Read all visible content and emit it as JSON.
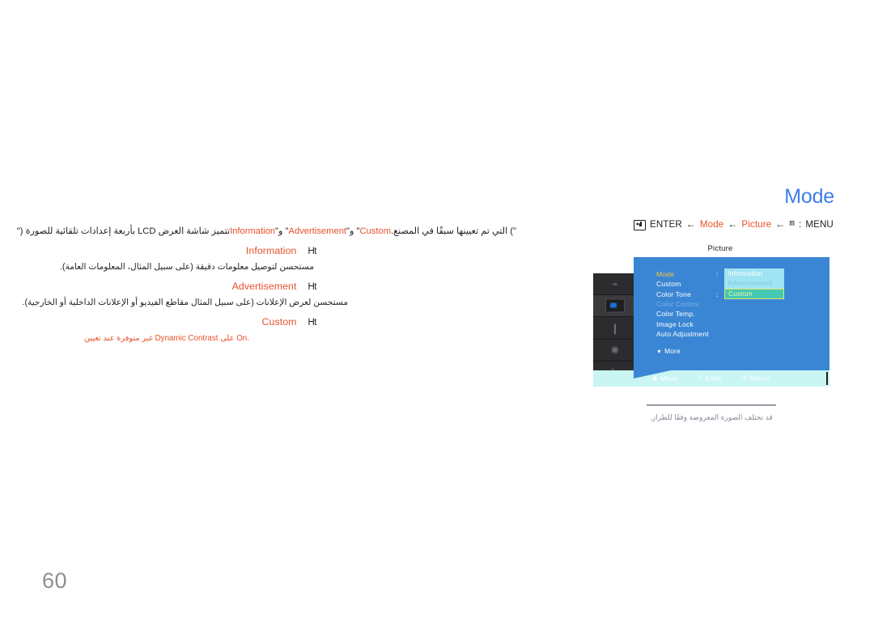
{
  "page": {
    "number": "60",
    "language": "ar"
  },
  "section": {
    "title": "Mode"
  },
  "breadcrumb": {
    "enter_icon": "enter-key-icon",
    "enter_label": "ENTER",
    "arrow": "←",
    "step_mode": "Mode",
    "step_picture": "Picture",
    "menu_glyph": "m",
    "menu_separator": ":",
    "menu_label": "MENU"
  },
  "body": {
    "intro": "تتميز شاشة العرض LCD بأربعة إعدادات تلقائية للصورة (\"Information\" و\"Advertisement\" و\"Custom\") التي تم تعيينها سبقًا في المصنع.",
    "intro_parts": {
      "a": "تتميز شاشة العرض LCD بأربعة إعدادات تلقائية للصورة (\"",
      "hl1": "Information",
      "b": "\" و\"",
      "hl2": "Advertisement",
      "c": "\" و\"",
      "hl3": "Custom",
      "d": "\") التي تم تعيينها سبقًا في المصنع."
    },
    "bullets": [
      {
        "mark": "Ht",
        "title": "Information",
        "desc": "مستحسن لتوصيل معلومات دقيقة (على سبيل المثال، المعلومات العامة)."
      },
      {
        "mark": "Ht",
        "title": "Advertisement",
        "desc": "مستحسن لعرض الإعلانات (على سبيل المثال مقاطع الفيديو أو الإعلانات الداخلية أو الخارجية)."
      },
      {
        "mark": "Ht",
        "title": "Custom",
        "note_pre": "غير متوفرة عند تعيين",
        "note_term": "Dynamic Contrast",
        "note_mid": "على",
        "note_value": "On",
        "note_end": "."
      }
    ]
  },
  "osd": {
    "header": "Picture",
    "rail": [
      {
        "name": "input-source-icon",
        "glyph": "⌁"
      },
      {
        "name": "picture-icon",
        "glyph": ""
      },
      {
        "name": "sound-icon",
        "glyph": "❙"
      },
      {
        "name": "setup-gear-icon",
        "glyph": "✺"
      },
      {
        "name": "system-icon",
        "glyph": "⊩"
      }
    ],
    "rows": [
      {
        "label": "Mode",
        "colon": ":",
        "state": "selected"
      },
      {
        "label": "Custom",
        "colon": "",
        "state": "normal"
      },
      {
        "label": "Color Tone",
        "colon": ":",
        "state": "normal"
      },
      {
        "label": "Color Control",
        "colon": "",
        "state": "dim"
      },
      {
        "label": "Color Temp.",
        "colon": "",
        "state": "normal"
      },
      {
        "label": "Image Lock",
        "colon": "",
        "state": "normal"
      },
      {
        "label": "Auto Adjustment",
        "colon": "",
        "state": "normal"
      }
    ],
    "more": {
      "caret": "▼",
      "label": "More"
    },
    "dropdown": {
      "options": [
        {
          "label": "Information",
          "state": "item"
        },
        {
          "label": "Advertisement",
          "state": "item"
        },
        {
          "label": "Custom",
          "state": "highlighted"
        }
      ]
    },
    "hints": [
      {
        "glyph": "◆",
        "label": "Move",
        "name": "move-hint"
      },
      {
        "glyph": "⏎",
        "label": "Enter",
        "name": "enter-hint"
      },
      {
        "glyph": "↺",
        "label": "Return",
        "name": "return-hint"
      }
    ]
  },
  "caption": {
    "model_note": "قد تختلف الصورة المعروضة وفقًا للطراز."
  },
  "colors": {
    "accent_blue": "#3d7fe8",
    "highlight_red": "#e8502a",
    "osd_panel": "#3a86d4",
    "osd_selected_label": "#f5c542",
    "osd_value_bg": "#9fe4f2",
    "osd_value_selected_bg": "#45c8b4",
    "osd_hintbar": "#c9f5f3"
  }
}
